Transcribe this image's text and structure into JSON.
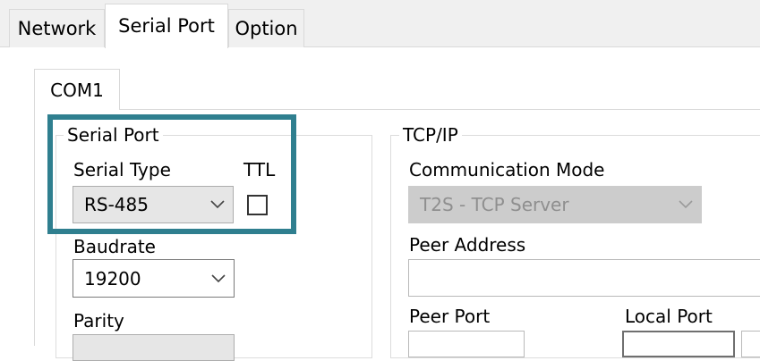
{
  "tabs": [
    {
      "label": "Network",
      "active": false
    },
    {
      "label": "Serial Port",
      "active": true
    },
    {
      "label": "Option",
      "active": false
    }
  ],
  "inner_tab": {
    "label": "COM1"
  },
  "serial_port_group": {
    "legend": "Serial Port",
    "serial_type": {
      "label": "Serial Type",
      "value": "RS-485"
    },
    "ttl": {
      "label": "TTL",
      "checked": false
    },
    "baudrate": {
      "label": "Baudrate",
      "value": "19200"
    },
    "parity": {
      "label": "Parity"
    }
  },
  "tcpip_group": {
    "legend": "TCP/IP",
    "communication_mode": {
      "label": "Communication Mode",
      "value": "T2S - TCP Server",
      "enabled": false
    },
    "peer_address": {
      "label": "Peer Address",
      "value": ""
    },
    "peer_port": {
      "label": "Peer Port"
    },
    "local_port": {
      "label": "Local Port"
    }
  },
  "highlight_color": "#2f7f8f"
}
